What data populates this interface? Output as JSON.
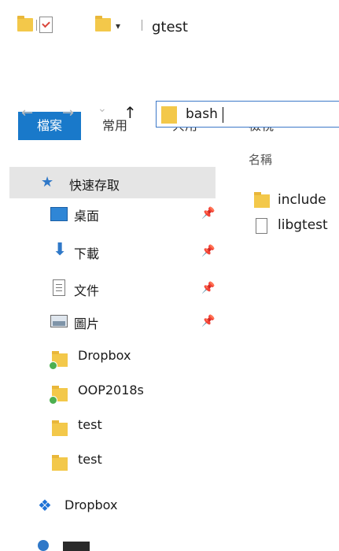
{
  "window": {
    "title": "gtest"
  },
  "quick_access_toolbar": {
    "icons": [
      "folder-icon",
      "properties-icon",
      "new-folder-icon",
      "customize-dropdown-icon"
    ],
    "dropdown_glyph": "▾"
  },
  "ribbon": {
    "tabs": [
      {
        "label": "檔案",
        "active": true
      },
      {
        "label": "常用"
      },
      {
        "label": "共用"
      },
      {
        "label": "檢視"
      }
    ],
    "accent": "#1979ca"
  },
  "address_bar": {
    "value": "bash",
    "buttons": {
      "back": "←",
      "forward": "→",
      "recent": "⌄",
      "up": "↑"
    }
  },
  "nav_pane": {
    "quick_access": {
      "label": "快速存取",
      "icon": "star-pin-icon"
    },
    "items": [
      {
        "label": "桌面",
        "icon": "desktop-icon",
        "pinned": true
      },
      {
        "label": "下載",
        "icon": "download-icon",
        "pinned": true
      },
      {
        "label": "文件",
        "icon": "documents-icon",
        "pinned": true
      },
      {
        "label": "圖片",
        "icon": "pictures-icon",
        "pinned": true
      },
      {
        "label": "Dropbox",
        "icon": "folder-sync-icon",
        "pinned": false
      },
      {
        "label": "OOP2018s",
        "icon": "folder-sync-icon",
        "pinned": false
      },
      {
        "label": "test",
        "icon": "folder-icon",
        "pinned": false
      },
      {
        "label": "test",
        "icon": "folder-icon",
        "pinned": false
      }
    ],
    "dropbox": {
      "label": "Dropbox",
      "icon": "dropbox-icon"
    },
    "pin_glyph": "📌"
  },
  "content": {
    "column_header": "名稱",
    "items": [
      {
        "name": "include",
        "type": "folder"
      },
      {
        "name": "libgtest",
        "type": "file"
      }
    ]
  }
}
